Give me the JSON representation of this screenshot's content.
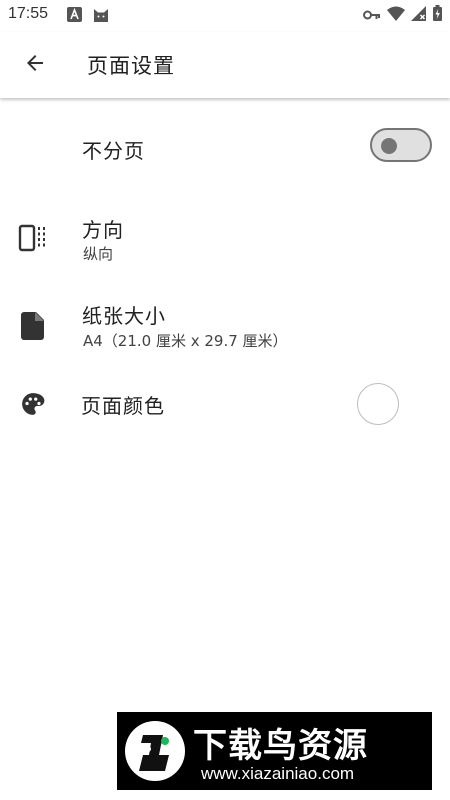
{
  "status_bar": {
    "time": "17:55",
    "left_icons": [
      "a-box-notification-icon",
      "cat-notification-icon"
    ],
    "right_icons": [
      "vpn-key-icon",
      "wifi-icon",
      "cellular-signal-icon",
      "battery-icon"
    ]
  },
  "app_bar": {
    "back_icon": "arrow-back-icon",
    "title": "页面设置"
  },
  "settings": {
    "no_pagination": {
      "title": "不分页",
      "enabled": false
    },
    "orientation": {
      "icon": "screen-rotation-icon",
      "title": "方向",
      "summary": "纵向"
    },
    "paper_size": {
      "icon": "description-icon",
      "title": "纸张大小",
      "summary": "A4（21.0 厘米 x 29.7 厘米）"
    },
    "page_color": {
      "icon": "palette-icon",
      "title": "页面颜色",
      "color": "#ffffff"
    }
  },
  "watermark": {
    "title": "下载鸟资源",
    "url": "www.xiazainiao.com"
  },
  "colors": {
    "text_primary": "#212121",
    "text_secondary": "#424242",
    "icon": "#333333",
    "switch_off": "#757575"
  }
}
